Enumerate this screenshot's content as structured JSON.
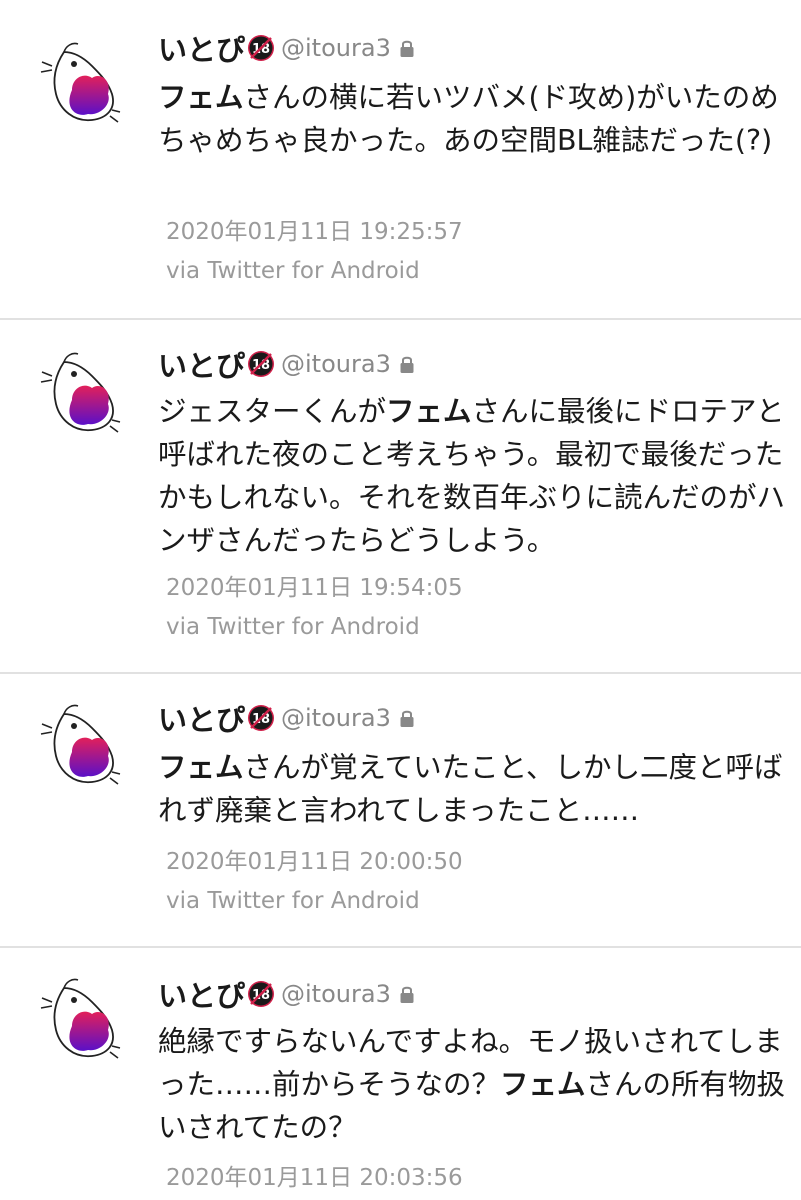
{
  "tweets": [
    {
      "name": "いとぴ",
      "handle": "@itoura3",
      "text_segments": [
        {
          "text": "フェム",
          "bold": true
        },
        {
          "text": "さんの横に若いツバメ(ド攻め)がいたのめちゃめちゃ良かった。あの空間BL雑誌だった(?)",
          "bold": false
        }
      ],
      "timestamp": "2020年01月11日 19:25:57",
      "source": "via Twitter for Android"
    },
    {
      "name": "いとぴ",
      "handle": "@itoura3",
      "text_segments": [
        {
          "text": "ジェスターくんが",
          "bold": false
        },
        {
          "text": "フェム",
          "bold": true
        },
        {
          "text": "さんに最後にドロテアと呼ばれた夜のこと考えちゃう。最初で最後だったかもしれない。それを数百年ぶりに読んだのがハンザさんだったらどうしよう。",
          "bold": false
        }
      ],
      "timestamp": "2020年01月11日 19:54:05",
      "source": "via Twitter for Android"
    },
    {
      "name": "いとぴ",
      "handle": "@itoura3",
      "text_segments": [
        {
          "text": "フェム",
          "bold": true
        },
        {
          "text": "さんが覚えていたこと、しかし二度と呼ばれず廃棄と言われてしまったこと……",
          "bold": false
        }
      ],
      "timestamp": "2020年01月11日 20:00:50",
      "source": "via Twitter for Android"
    },
    {
      "name": "いとぴ",
      "handle": "@itoura3",
      "text_segments": [
        {
          "text": "絶縁ですらないんですよね。モノ扱いされてしまった……前からそうなの？",
          "bold": false
        },
        {
          "text": "フェム",
          "bold": true
        },
        {
          "text": "さんの所有物扱いされてたの？",
          "bold": false
        }
      ],
      "timestamp": "2020年01月11日 20:03:56",
      "source": ""
    }
  ],
  "badge_icon": "r18-badge-icon",
  "lock_icon": "lock-icon",
  "colors": {
    "text": "#1a1a1a",
    "handle": "#888888",
    "meta": "#9a9a9a",
    "divider": "#e1e1e1",
    "badge": "#d0204a",
    "avatar_blob_top": "#e2205a",
    "avatar_blob_bottom": "#5a10c8"
  }
}
